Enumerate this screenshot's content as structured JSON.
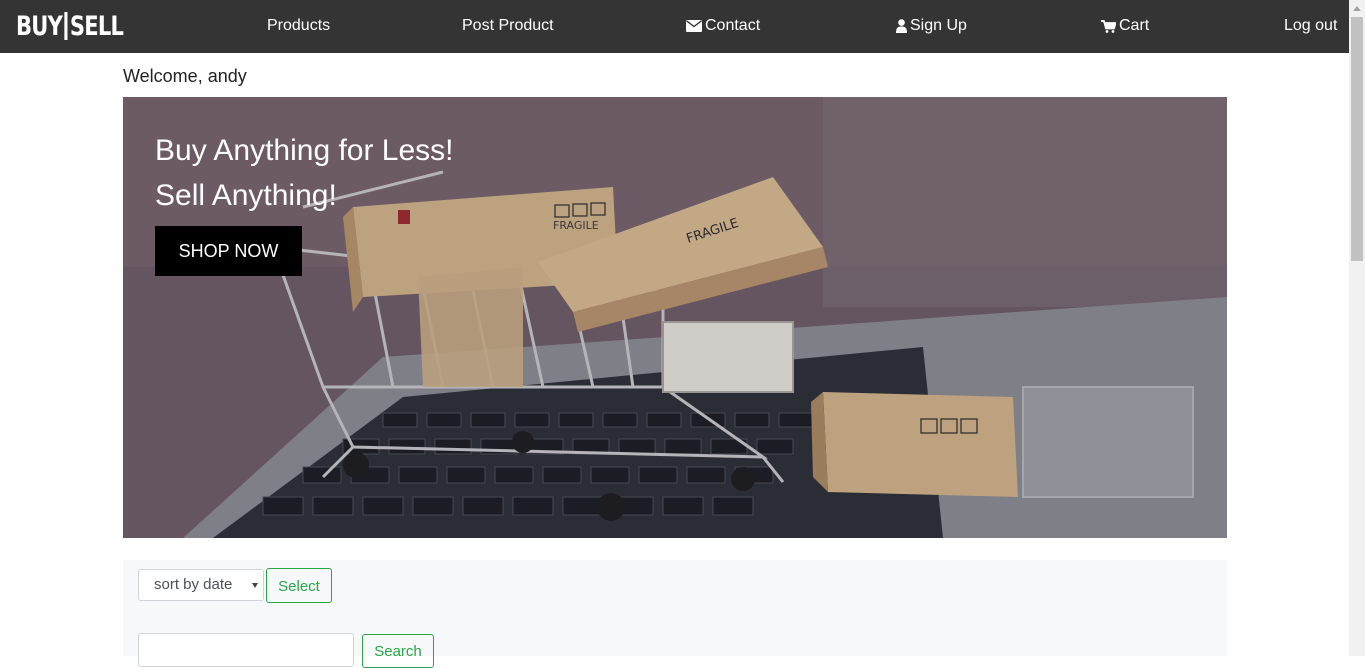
{
  "nav": {
    "logo_left": "BUY",
    "logo_right": "SELL",
    "products": "Products",
    "post_product": "Post Product",
    "contact": "Contact",
    "sign_up": "Sign Up",
    "cart": "Cart",
    "log_out": "Log out"
  },
  "welcome": "Welcome, andy",
  "hero": {
    "line1": "Buy Anything for Less!",
    "line2": "Sell Anything!",
    "cta": "SHOP NOW",
    "box_label": "FRAGILE"
  },
  "filters": {
    "sort_value": "sort by date",
    "select_label": "Select",
    "search_value": "",
    "search_label": "Search"
  },
  "icons": {
    "contact": "envelope-icon",
    "sign_up": "user-icon",
    "cart": "cart-icon"
  }
}
